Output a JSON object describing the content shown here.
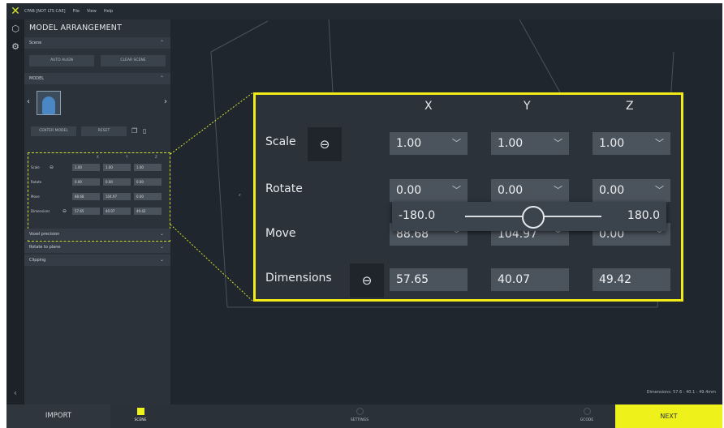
{
  "menubar": {
    "project": "CFAB [NOT LTS CAE]",
    "menu": [
      "File",
      "View",
      "Help"
    ]
  },
  "panel": {
    "title": "MODEL ARRANGEMENT",
    "scene_section": "Scene",
    "auto_align": "AUTO ALIGN",
    "clear_scene": "CLEAR SCENE",
    "model_section": "MODEL",
    "center_model": "CENTER MODEL",
    "reset": "RESET",
    "mini": {
      "headers": [
        "X",
        "Y",
        "Z"
      ],
      "rows": [
        {
          "label": "Scale",
          "values": [
            "1.00",
            "1.00",
            "1.00"
          ]
        },
        {
          "label": "Rotate",
          "values": [
            "0.00",
            "0.00",
            "0.00"
          ]
        },
        {
          "label": "Move",
          "values": [
            "88.68",
            "104.97",
            "0.00"
          ]
        },
        {
          "label": "Dimensions",
          "values": [
            "57.65",
            "40.07",
            "49.42"
          ]
        }
      ]
    },
    "voxel_precision": "Voxel precision",
    "rotate_to_plane": "Rotate to plane",
    "clipping": "Clipping"
  },
  "zoom": {
    "headers": [
      "X",
      "Y",
      "Z"
    ],
    "scale_label": "Scale",
    "rotate_label": "Rotate",
    "move_label": "Move",
    "dimensions_label": "Dimensions",
    "scale": [
      "1.00",
      "1.00",
      "1.00"
    ],
    "rotate": [
      "0.00",
      "0.00",
      "0.00"
    ],
    "move": [
      "88.68",
      "104.97",
      "0.00"
    ],
    "dimensions": [
      "57.65",
      "40.07",
      "49.42"
    ],
    "slider": {
      "min": "-180.0",
      "max": "180.0",
      "value_fraction": 0.5
    }
  },
  "viewport": {
    "axis_label": "z",
    "dims_text": "Dimensions: 57.6 : 40.1 : 49.4mm"
  },
  "bottom": {
    "import": "IMPORT",
    "scene": "SCENE",
    "settings": "SETTINGS",
    "gcode": "GCODE",
    "next": "NEXT"
  },
  "colors": {
    "accent": "#eef21a",
    "highlight": "#f1ec18"
  },
  "icons": {
    "logo": "x-logo-icon",
    "model": "cube-icon",
    "support": "settings-icon"
  }
}
